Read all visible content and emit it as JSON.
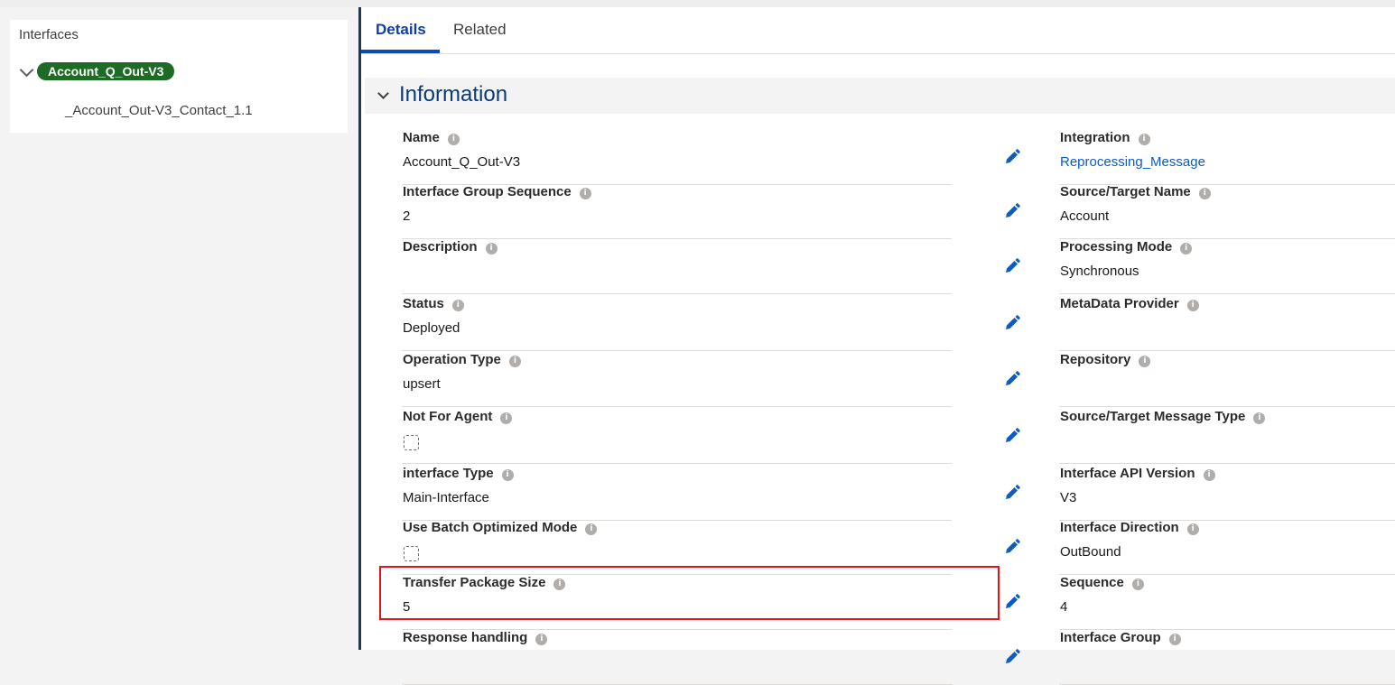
{
  "tree": {
    "title": "Interfaces",
    "root": "Account_Q_Out-V3",
    "child": "_Account_Out-V3_Contact_1.1"
  },
  "tabs": {
    "details": "Details",
    "related": "Related"
  },
  "section": {
    "title": "Information"
  },
  "left_fields": [
    {
      "label": "Name",
      "value": "Account_Q_Out-V3"
    },
    {
      "label": "Interface Group Sequence",
      "value": "2"
    },
    {
      "label": "Description",
      "value": ""
    },
    {
      "label": "Status",
      "value": "Deployed"
    },
    {
      "label": "Operation Type",
      "value": "upsert"
    },
    {
      "label": "Not For Agent",
      "checkbox": false
    },
    {
      "label": "interface Type",
      "value": "Main-Interface"
    },
    {
      "label": "Use Batch Optimized Mode",
      "checkbox": false
    },
    {
      "label": "Transfer Package Size",
      "value": "5"
    },
    {
      "label": "Response handling",
      "value": ""
    }
  ],
  "right_fields": [
    {
      "label": "Integration",
      "value": "Reprocessing_Message"
    },
    {
      "label": "Source/Target Name",
      "value": "Account"
    },
    {
      "label": "Processing Mode",
      "value": "Synchronous"
    },
    {
      "label": "MetaData Provider",
      "value": ""
    },
    {
      "label": "Repository",
      "value": ""
    },
    {
      "label": "Source/Target Message Type",
      "value": ""
    },
    {
      "label": "Interface API Version",
      "value": "V3"
    },
    {
      "label": "Interface Direction",
      "value": "OutBound"
    },
    {
      "label": "Sequence",
      "value": "4"
    },
    {
      "label": "Interface Group",
      "value": ""
    }
  ],
  "info_glyph": "i",
  "icons": {
    "edit": "pencil-icon",
    "info": "info-icon",
    "expand": "chevron-down-icon"
  },
  "colors": {
    "accent": "#0b4cb8",
    "pill": "#1e6b25",
    "link": "#0b5cc9",
    "highlight": "#e0141b"
  }
}
